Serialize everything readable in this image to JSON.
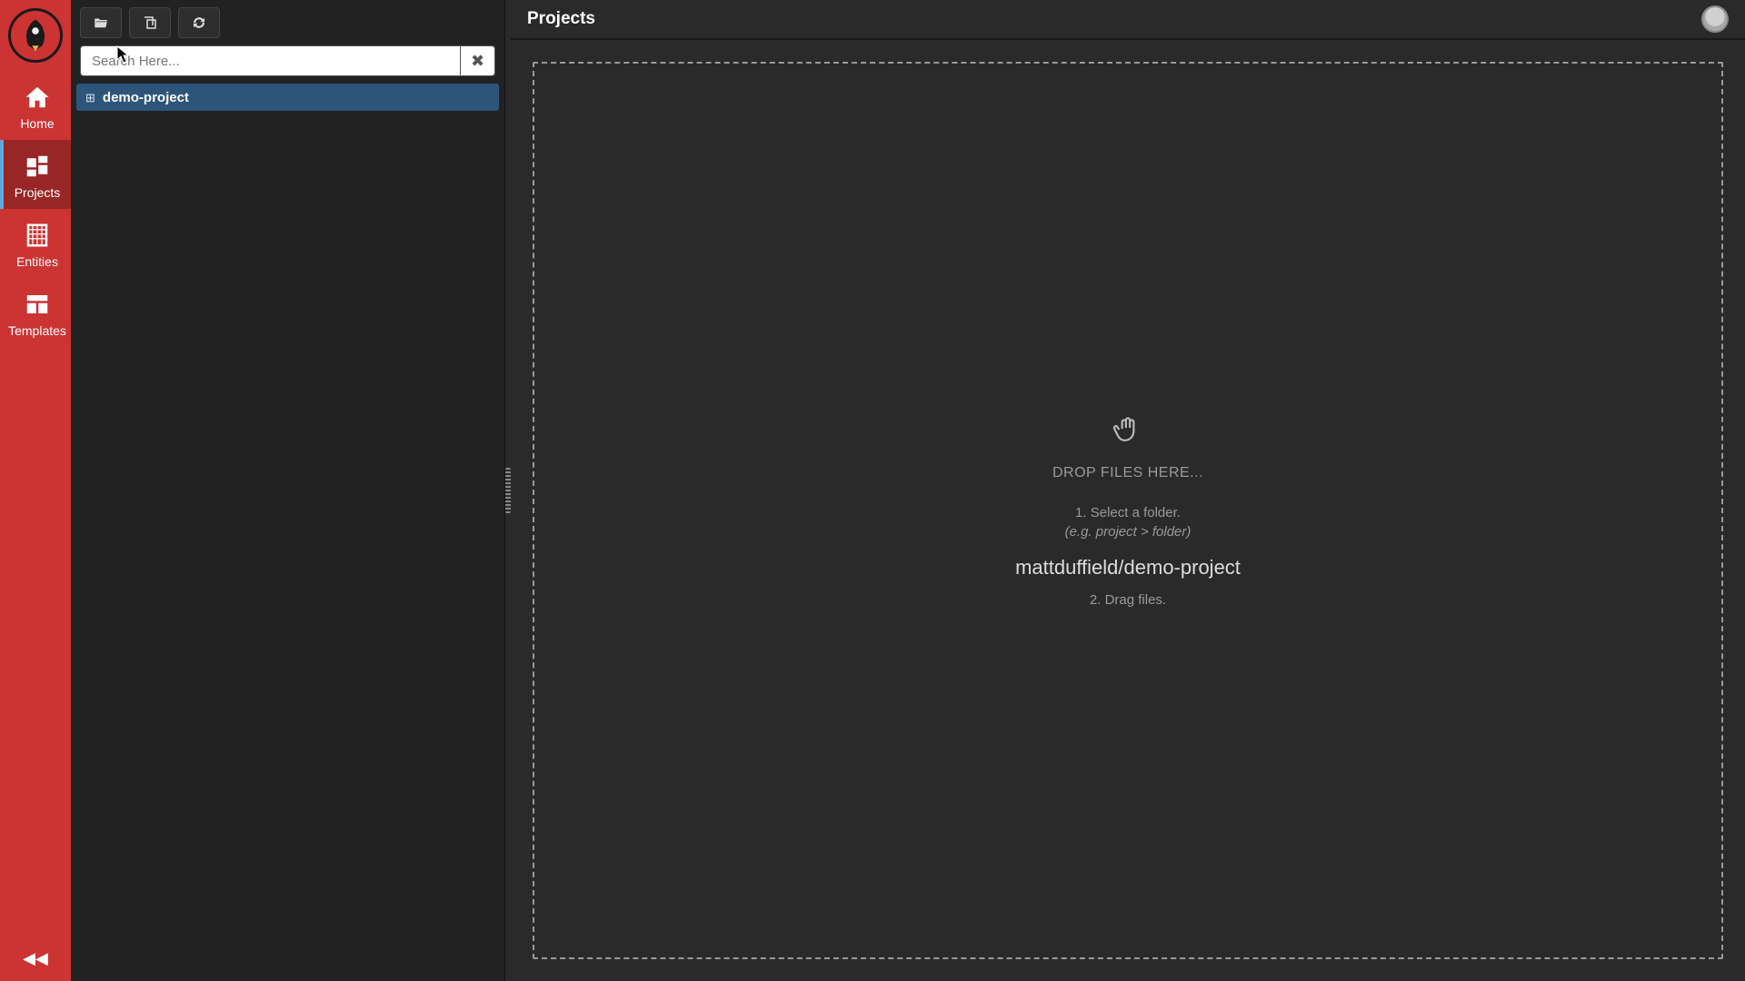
{
  "nav": {
    "items": [
      {
        "label": "Home"
      },
      {
        "label": "Projects"
      },
      {
        "label": "Entities"
      },
      {
        "label": "Templates"
      }
    ],
    "active_index": 1
  },
  "explorer": {
    "search": {
      "placeholder": "Search Here...",
      "value": ""
    },
    "tree": [
      {
        "name": "demo-project",
        "expanded": false
      }
    ]
  },
  "main": {
    "title": "Projects",
    "dropzone": {
      "headline": "DROP FILES HERE...",
      "step1": "1. Select a folder.",
      "hint": "(e.g. project > folder)",
      "path": "mattduffield/demo-project",
      "step2": "2. Drag files."
    }
  },
  "icons": {
    "folder_open": "folder-open-icon",
    "clone": "clone-icon",
    "sync": "sync-icon"
  }
}
